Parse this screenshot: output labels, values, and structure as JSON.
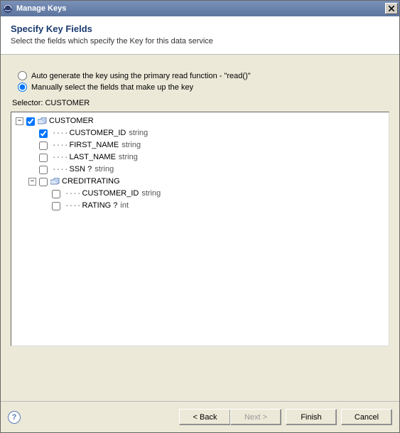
{
  "window": {
    "title": "Manage Keys"
  },
  "header": {
    "title": "Specify Key Fields",
    "subtitle": "Select the fields which specify the Key for this data service"
  },
  "options": {
    "auto_label": "Auto generate the key using the primary read function - \"read()\"",
    "manual_label": "Manually select the fields that make up the key",
    "selected": "manual"
  },
  "selector": {
    "label_prefix": "Selector:",
    "name": "CUSTOMER"
  },
  "tree": {
    "root": {
      "name": "CUSTOMER",
      "checked": true,
      "expanded": true,
      "children": [
        {
          "name": "CUSTOMER_ID",
          "type": "string",
          "checked": true
        },
        {
          "name": "FIRST_NAME",
          "type": "string",
          "checked": false
        },
        {
          "name": "LAST_NAME",
          "type": "string",
          "checked": false
        },
        {
          "name": "SSN",
          "optional": true,
          "type": "string",
          "checked": false
        },
        {
          "name": "CREDITRATING",
          "checked": false,
          "expanded": true,
          "children": [
            {
              "name": "CUSTOMER_ID",
              "type": "string",
              "checked": false
            },
            {
              "name": "RATING",
              "optional": true,
              "type": "int",
              "checked": false
            }
          ]
        }
      ]
    }
  },
  "buttons": {
    "back": "< Back",
    "next": "Next >",
    "finish": "Finish",
    "cancel": "Cancel"
  }
}
